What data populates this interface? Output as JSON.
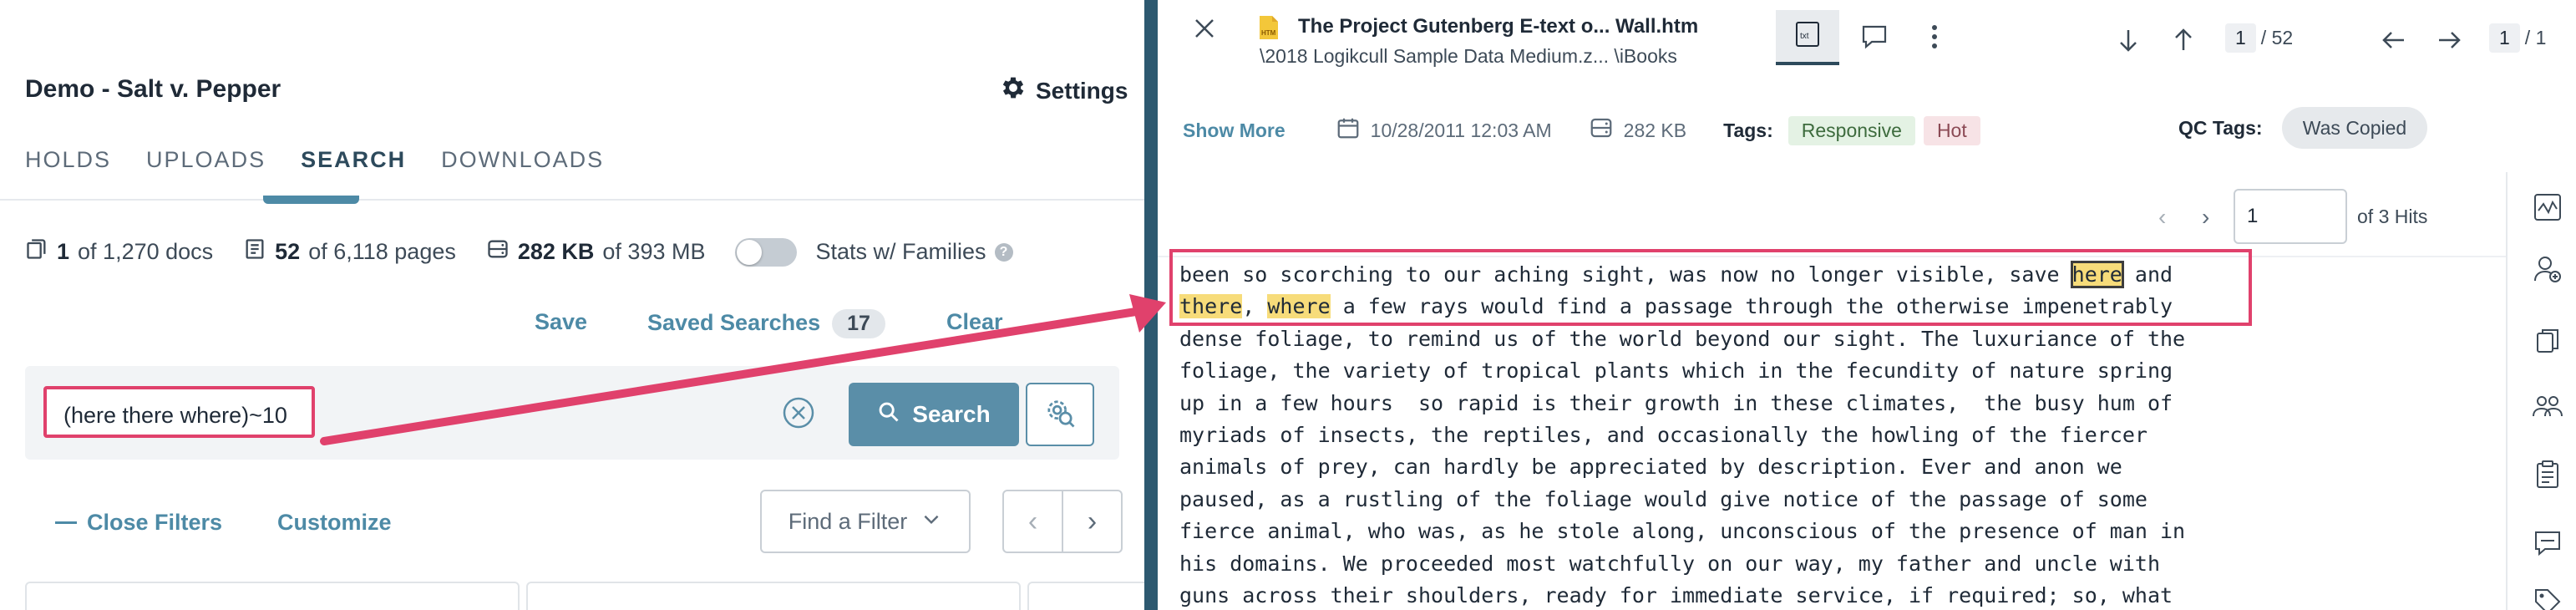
{
  "left": {
    "matter_title": "Demo - Salt v. Pepper",
    "settings_label": "Settings",
    "tabs": [
      {
        "label": "HOLDS"
      },
      {
        "label": "UPLOADS"
      },
      {
        "label": "SEARCH"
      },
      {
        "label": "DOWNLOADS"
      }
    ],
    "active_tab": "SEARCH",
    "stats": {
      "docs_current": "1",
      "docs_total": "of 1,270 docs",
      "pages_current": "52",
      "pages_total": "of 6,118 pages",
      "size_current": "282 KB",
      "size_total": "of 393 MB",
      "families_label": "Stats w/ Families",
      "families_toggle": false
    },
    "actions": {
      "save": "Save",
      "saved_searches": "Saved Searches",
      "saved_count": "17",
      "clear": "Clear"
    },
    "search": {
      "query": "(here there where)~10",
      "button_label": "Search"
    },
    "filters": {
      "close_filters": "Close Filters",
      "customize": "Customize",
      "find_filter": "Find a Filter"
    }
  },
  "viewer": {
    "doc_title": "The Project Gutenberg E-text o...  Wall.htm",
    "doc_path": "\\2018 Logikcull Sample Data Medium.z...  \\iBooks",
    "view_mode_label": "txt",
    "page_current": "1",
    "page_total": "/ 52",
    "doc_current": "1",
    "doc_total": "/ 1",
    "meta": {
      "show_more": "Show More",
      "date": "10/28/2011 12:03 AM",
      "size": "282 KB",
      "tags_label": "Tags:",
      "tag1": "Responsive",
      "tag2": "Hot",
      "qc_label": "QC Tags:",
      "qc_tag": "Was Copied"
    },
    "hits": {
      "current": "1",
      "of_label": "of 3 Hits"
    },
    "text_lines": [
      "dense foliage, to remind us of the world beyond our sight. The luxuriance of the",
      "foliage, the variety of tropical plants which in the fecundity of nature spring",
      "up in a few hours  so rapid is their growth in these climates,  the busy hum of",
      "myriads of insects, the reptiles, and occasionally the howling of the fiercer",
      "animals of prey, can hardly be appreciated by description. Ever and anon we",
      "paused, as a rustling of the foliage would give notice of the passage of some",
      "fierce animal, who was, as he stole along, unconscious of the presence of man in",
      "his domains. We proceeded most watchfully on our way, my father and uncle with",
      "guns across their shoulders, ready for immediate service, if required; so, what"
    ],
    "line1_pre": "been so scorching to our aching sight, was now no longer visible, save ",
    "hit1": "here",
    "line1_post": " and",
    "hit2": "there",
    "line2_mid": ", ",
    "hit3": "where",
    "line2_post": " a few rays would find a passage through the otherwise impenetrably"
  },
  "colors": {
    "accent": "#4d8aa6",
    "highlight_box": "#e0416c",
    "hit_highlight": "#f7dc7a",
    "divider": "#2d5970"
  }
}
